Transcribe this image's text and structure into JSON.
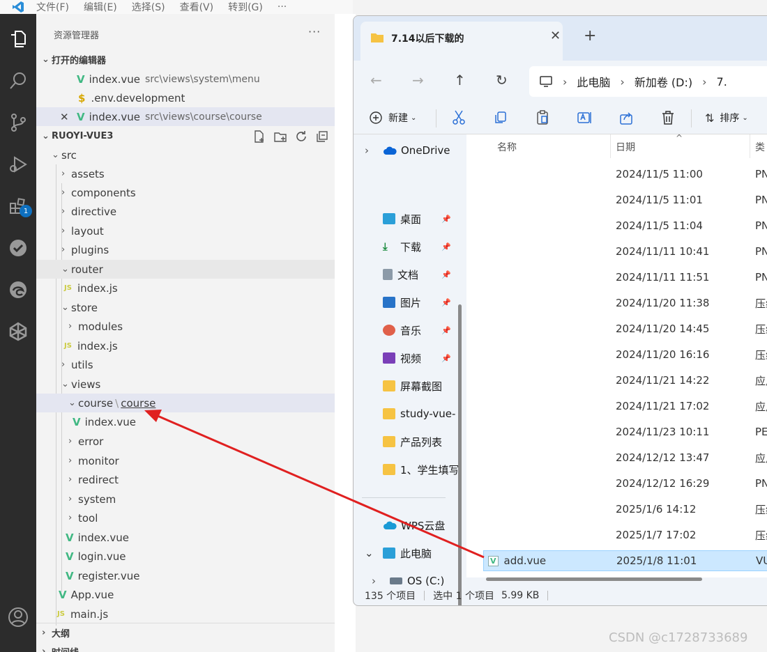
{
  "vscode": {
    "menu": [
      "文件(F)",
      "编辑(E)",
      "选择(S)",
      "查看(V)",
      "转到(G)"
    ],
    "menu_more": "···",
    "search_title": "RuoYi-Vue3",
    "sidebar_title": "资源管理器",
    "sidebar_more": "···",
    "extensions_badge": "1",
    "open_editors_label": "打开的编辑器",
    "open_editors": [
      {
        "name": "index.vue",
        "path": "src\\views\\system\\menu"
      },
      {
        "name": ".env.development",
        "path": ""
      },
      {
        "name": "index.vue",
        "path": "src\\views\\course\\course"
      }
    ],
    "project_label": "RUOYI-VUE3",
    "tree": {
      "src": "src",
      "assets": "assets",
      "components": "components",
      "directive": "directive",
      "layout": "layout",
      "plugins": "plugins",
      "router": "router",
      "router_index": "index.js",
      "store": "store",
      "modules": "modules",
      "store_index": "index.js",
      "utils": "utils",
      "views": "views",
      "course_a": "course",
      "course_b": "course",
      "course_index": "index.vue",
      "error": "error",
      "monitor": "monitor",
      "redirect": "redirect",
      "system": "system",
      "tool": "tool",
      "views_index": "index.vue",
      "login": "login.vue",
      "register": "register.vue",
      "app": "App.vue",
      "main": "main.js"
    },
    "outline_label": "大纲",
    "timeline_label": "时间线",
    "icon_vue": "V",
    "icon_js": "JS",
    "icon_env": "$"
  },
  "explorer": {
    "tab_title": "7.14以后下载的",
    "breadcrumb": [
      "此电脑",
      "新加卷 (D:)",
      "7."
    ],
    "toolbar": {
      "new": "新建",
      "sort": "排序"
    },
    "columns": {
      "name": "名称",
      "date": "日期",
      "type": "类"
    },
    "nav": {
      "onedrive": "OneDrive",
      "desktop": "桌面",
      "downloads": "下载",
      "documents": "文档",
      "pictures": "图片",
      "music": "音乐",
      "videos": "视频",
      "screenshots": "屏幕截图",
      "study": "study-vue-",
      "products": "产品列表",
      "student": "1、学生填写",
      "wps": "WPS云盘",
      "thispc": "此电脑",
      "osc": "OS (C:)"
    },
    "files": [
      {
        "name": "",
        "date": "2024/11/5 11:00",
        "type": "PN"
      },
      {
        "name": "",
        "date": "2024/11/5 11:01",
        "type": "PN"
      },
      {
        "name": "",
        "date": "2024/11/5 11:04",
        "type": "PN"
      },
      {
        "name": "",
        "date": "2024/11/11 10:41",
        "type": "PN"
      },
      {
        "name": "",
        "date": "2024/11/11 11:51",
        "type": "PN"
      },
      {
        "name": "",
        "date": "2024/11/20 11:38",
        "type": "压缩"
      },
      {
        "name": "",
        "date": "2024/11/20 14:45",
        "type": "压缩"
      },
      {
        "name": "",
        "date": "2024/11/20 16:16",
        "type": "压缩"
      },
      {
        "name": "",
        "date": "2024/11/21 14:22",
        "type": "应用"
      },
      {
        "name": "",
        "date": "2024/11/21 17:02",
        "type": "应用"
      },
      {
        "name": "",
        "date": "2024/11/23 10:11",
        "type": "PE"
      },
      {
        "name": "",
        "date": "2024/12/12 13:47",
        "type": "应用"
      },
      {
        "name": "",
        "date": "2024/12/12 16:29",
        "type": "PN"
      },
      {
        "name": "",
        "date": "2025/1/6 14:12",
        "type": "压缩"
      },
      {
        "name": "",
        "date": "2025/1/7 17:02",
        "type": "压缩"
      },
      {
        "name": "add.vue",
        "date": "2025/1/8 11:01",
        "type": "VU"
      }
    ],
    "status": {
      "count": "135 个项目",
      "selected": "选中 1 个项目",
      "size": "5.99 KB"
    }
  },
  "watermark": "CSDN @c1728733689",
  "colors": {
    "vue_green": "#41b883",
    "arrow_red": "#e02020",
    "selection": "#cce8ff"
  }
}
